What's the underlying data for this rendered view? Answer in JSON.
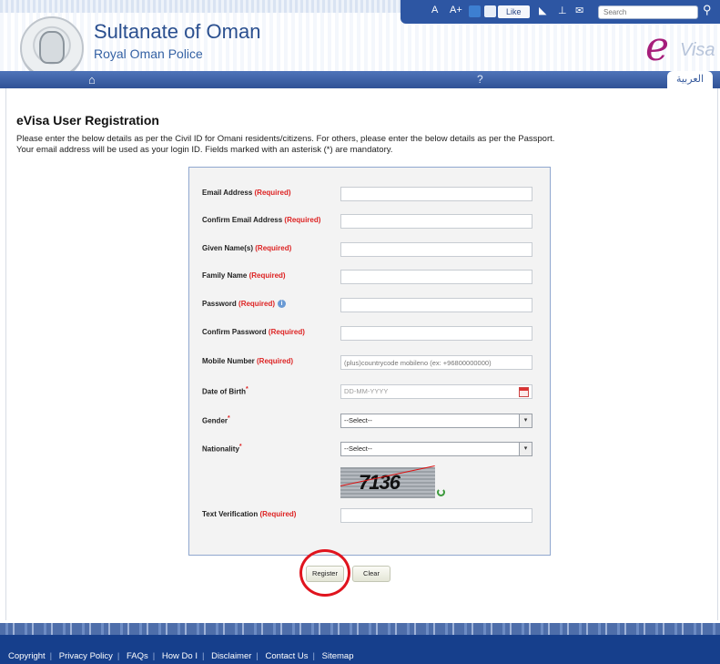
{
  "header": {
    "title": "Sultanate of Oman",
    "subtitle": "Royal Oman Police",
    "home_icon": "home-icon",
    "help_glyph": "?",
    "language_tab": "العربية",
    "logo_letter": "e",
    "logo_text": "Visa"
  },
  "toolbar": {
    "font_decrease": "A",
    "font_increase": "A+",
    "like_label": "Like",
    "search_placeholder": "Search"
  },
  "page": {
    "title": "eVisa User Registration",
    "intro_line1": "Please enter the below details as per the Civil ID for Omani residents/citizens. For others, please enter the below details as per the Passport.",
    "intro_line2": "Your email address will be used as your login ID. Fields marked with an asterisk (*) are mandatory."
  },
  "form": {
    "required_tag": "(Required)",
    "fields": {
      "email": {
        "label": "Email Address",
        "value": ""
      },
      "confirm_email": {
        "label": "Confirm Email Address",
        "value": ""
      },
      "given_name": {
        "label": "Given Name(s)",
        "value": ""
      },
      "family_name": {
        "label": "Family Name",
        "value": ""
      },
      "password": {
        "label": "Password",
        "value": ""
      },
      "confirm_password": {
        "label": "Confirm Password",
        "value": ""
      },
      "mobile": {
        "label": "Mobile Number",
        "placeholder": "(plus)countrycode mobileno (ex: +96800000000)"
      },
      "dob": {
        "label": "Date of Birth",
        "placeholder": "DD-MM-YYYY"
      },
      "gender": {
        "label": "Gender",
        "selected": "--Select--"
      },
      "nationality": {
        "label": "Nationality",
        "selected": "--Select--"
      },
      "text_verification": {
        "label": "Text Verification",
        "value": ""
      }
    },
    "captcha_text": "7136",
    "register_label": "Register",
    "clear_label": "Clear"
  },
  "footer": {
    "links": [
      "Copyright",
      "Privacy Policy",
      "FAQs",
      "How Do I",
      "Disclaimer",
      "Contact Us",
      "Sitemap"
    ]
  },
  "colors": {
    "brand_blue": "#2d56a3",
    "required_red": "#dd2222",
    "annotation_red": "#e0141e"
  }
}
